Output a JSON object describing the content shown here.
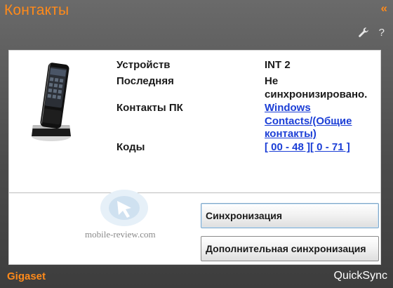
{
  "window": {
    "title": "Контакты",
    "collapse_label": "«"
  },
  "toolbar": {
    "settings_icon": "wrench-icon",
    "help_label": "?"
  },
  "device": {
    "rows": [
      {
        "label": "Устройств",
        "value": "INT 2"
      },
      {
        "label": "Последняя",
        "value": "Не синхронизировано."
      },
      {
        "label": "Контакты ПК",
        "value": "Windows Contacts/(Общие контакты)"
      },
      {
        "label": "Коды",
        "value": "[ 00 - 48 ][ 0 - 71 ]"
      }
    ]
  },
  "watermark": {
    "text": "mobile-review.com"
  },
  "actions": {
    "sync_label": "Синхронизация",
    "more_sync_label": "Дополнительная синхронизация"
  },
  "footer": {
    "brand": "Gigaset",
    "product": "QuickSync"
  },
  "colors": {
    "accent": "#ff8a1a",
    "link": "#1c3fd6",
    "background": "#4c4c4c"
  }
}
